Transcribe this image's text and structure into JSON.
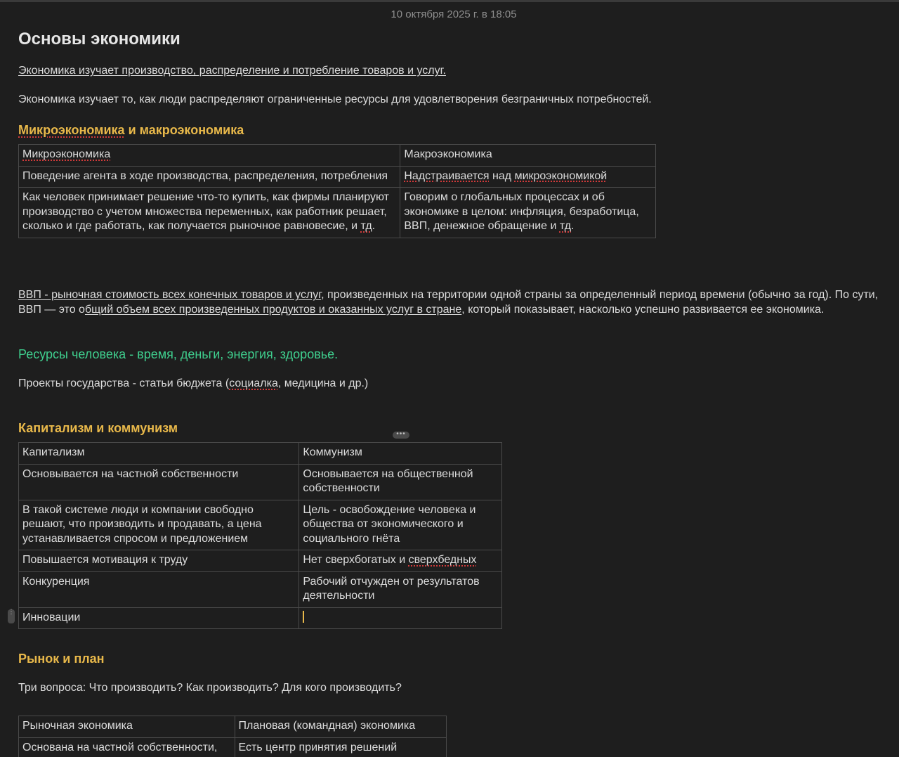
{
  "timestamp": "10 октября 2025 г. в 18:05",
  "title": "Основы экономики",
  "intro_underlined": "Экономика изучает производство, распределение и потребление товаров и услуг.",
  "intro_text": "Экономика изучает то, как люди распределяют ограниченные ресурсы для удовлетворения безграничных потребностей.",
  "section1": {
    "heading_word1": "Микроэкономика",
    "heading_rest": " и макроэкономика",
    "table": {
      "header": [
        "Микроэкономика",
        "Макроэкономика"
      ],
      "r1c1": "Поведение агента в ходе производства, распределения, потребления",
      "r1c2_a": "Надстраивается",
      "r1c2_b": " над ",
      "r1c2_c": "микроэкономикой",
      "r2c1_a": "Как человек принимает решение что-то купить, как фирмы планируют производство с учетом множества переменных, как работник решает, сколько и где работать, как получается рыночное равновесие, и ",
      "r2c1_b": "тд",
      "r2c1_c": ".",
      "r2c2_a": "Говорим о глобальных процессах и об экономике в целом: инфляция, безработица, ВВП, денежное обращение и ",
      "r2c2_b": "тд",
      "r2c2_c": "."
    }
  },
  "gdp": {
    "part1_u": "ВВП - рыночная стоимость всех конечных товаров и услуг",
    "part2": ", произведенных на территории одной страны за определенный период времени (обычно за год). По сути, ВВП — это о",
    "part3_u": "бщий объем всех произведенных продуктов и оказанных услуг в стране",
    "part4": ", который показывает, насколько успешно развивается ее экономика."
  },
  "resources": "Ресурсы человека - время, деньги, энергия, здоровье.",
  "projects_a": "Проекты государства - статьи бюджета (",
  "projects_b": "социалка",
  "projects_c": ", медицина и др.)",
  "section2": {
    "heading": "Капитализм и коммунизм",
    "table": {
      "header": [
        "Капитализм",
        "Коммунизм"
      ],
      "rows": [
        [
          "Основывается на частной собственности",
          "Основывается на общественной собственности"
        ],
        [
          "В такой системе люди и компании свободно решают, что производить и продавать, а цена устанавливается спросом и предложением",
          "Цель - освобождение человека и общества от экономического и социального гнёта"
        ],
        [
          "Повышается мотивация к труду",
          "Нет сверхбогатых и "
        ],
        [
          "Конкуренция",
          "Рабочий отчужден от результатов деятельности"
        ],
        [
          "Инновации",
          ""
        ]
      ],
      "r3c2_spell": "сверхбедных"
    }
  },
  "section3": {
    "heading": "Рынок и план",
    "questions": "Три вопроса: Что производить? Как производить? Для кого производить?",
    "table": {
      "header": [
        "Рыночная экономика",
        "Плановая (командная) экономика"
      ],
      "r1": [
        "Основана на частной собственности,",
        "Есть центр принятия решений"
      ]
    }
  }
}
